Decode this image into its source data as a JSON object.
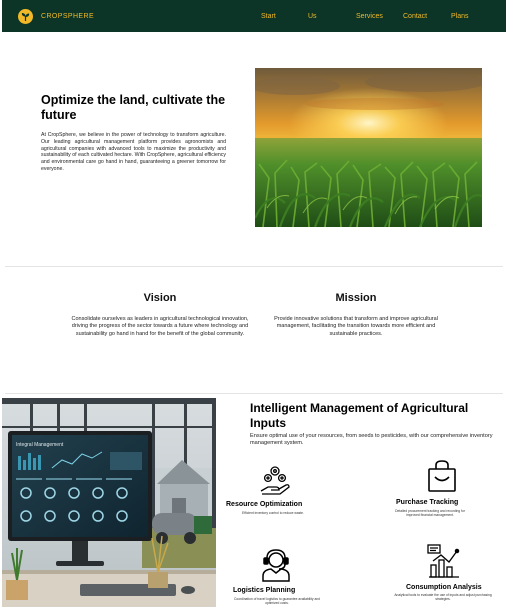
{
  "nav": {
    "brand": "CROPSPHERE",
    "links": [
      "Start",
      "Us",
      "Services",
      "Contact",
      "Plans"
    ]
  },
  "hero": {
    "title": "Optimize the land, cultivate the future",
    "text": "At CropSphere, we believe in the power of technology to transform agriculture. Our leading agricultural management platform provides agronomists and agricultural companies with advanced tools to maximize the productivity and sustainability of each cultivated hectare. With CropSphere, agricultural efficiency and environmental care go hand in hand, guaranteeing a greener tomorrow for everyone."
  },
  "vision": {
    "title": "Vision",
    "text": "Consolidate ourselves as leaders in agricultural technological innovation, driving the progress of the sector towards a future where technology and sustainability go hand in hand for the benefit of the global community."
  },
  "mission": {
    "title": "Mission",
    "text": "Provide innovative solutions that transform and improve agricultural management, facilitating the transition towards more efficient and sustainable practices."
  },
  "inputs": {
    "title": "Intelligent Management of Agricultural Inputs",
    "subtitle": "Ensure optimal use of your resources, from seeds to pesticides, with our comprehensive inventory management system.",
    "screen_title": "Integral Management",
    "features": [
      {
        "title": "Resource Optimization",
        "desc": "Efficient inventory control to reduce waste.",
        "icon": "hand-gears-icon"
      },
      {
        "title": "Purchase Tracking",
        "desc": "Detailed procurement tracking and recording for improved financial management.",
        "icon": "shopping-bag-icon"
      },
      {
        "title": "Logistics Planning",
        "desc": "Coordination of travel logistics to guarantee availability and optimized costs.",
        "icon": "support-agent-icon"
      },
      {
        "title": "Consumption Analysis",
        "desc": "Analytical tools to evaluate the use of inputs and adjust purchasing strategies.",
        "icon": "analytics-chart-icon"
      }
    ]
  },
  "colors": {
    "nav_bg": "#0d3527",
    "accent": "#f1b928"
  }
}
